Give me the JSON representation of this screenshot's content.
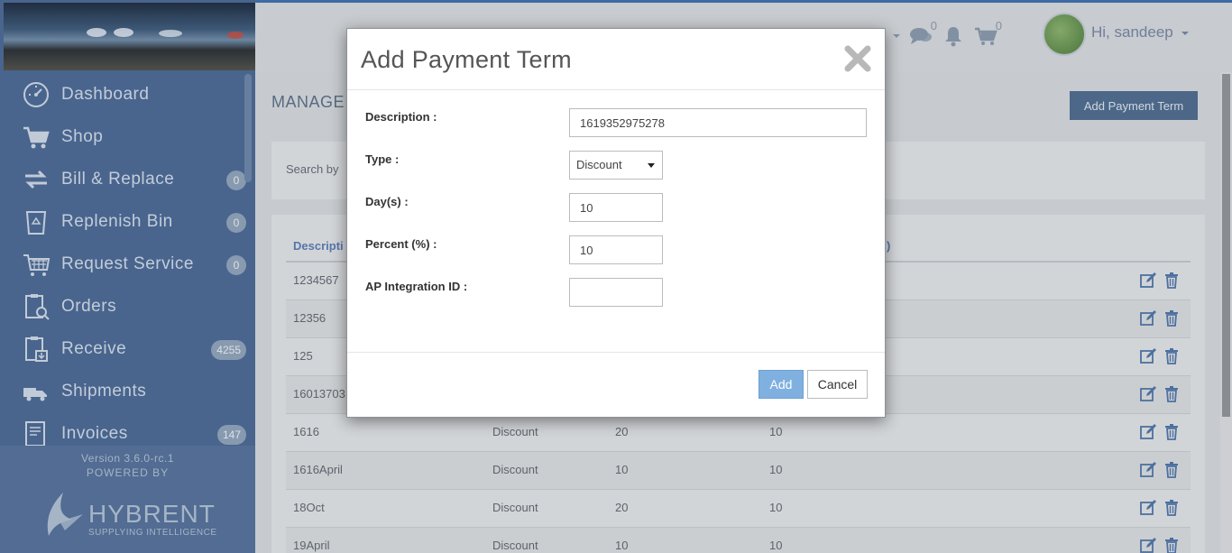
{
  "sidebar": {
    "items": [
      {
        "label": "Dashboard",
        "icon": "dashboard-icon",
        "badge": ""
      },
      {
        "label": "Shop",
        "icon": "cart-icon",
        "badge": ""
      },
      {
        "label": "Bill & Replace",
        "icon": "exchange-icon",
        "badge": "0"
      },
      {
        "label": "Replenish Bin",
        "icon": "recycle-bin-icon",
        "badge": "0"
      },
      {
        "label": "Request Service",
        "icon": "service-cart-icon",
        "badge": "0"
      },
      {
        "label": "Orders",
        "icon": "clipboard-search-icon",
        "badge": ""
      },
      {
        "label": "Receive",
        "icon": "clipboard-receive-icon",
        "badge": "4255"
      },
      {
        "label": "Shipments",
        "icon": "truck-icon",
        "badge": ""
      },
      {
        "label": "Invoices",
        "icon": "invoice-icon",
        "badge": "147"
      }
    ],
    "version": "Version 3.6.0-rc.1",
    "powered_by": "POWERED BY",
    "logo_word": "HYBRENT",
    "logo_tagline": "SUPPLYING INTELLIGENCE"
  },
  "header": {
    "messages_count": "0",
    "cart_count": "0",
    "greeting": "Hi, sandeep"
  },
  "page": {
    "title": "MANAGE",
    "add_button": "Add Payment Term",
    "search_label": "Search by",
    "columns": [
      "Descripti",
      ")"
    ],
    "rows": [
      {
        "description": "1234567",
        "type": "",
        "days": "",
        "percent": ""
      },
      {
        "description": "12356",
        "type": "",
        "days": "",
        "percent": ""
      },
      {
        "description": "125",
        "type": "",
        "days": "",
        "percent": ""
      },
      {
        "description": "16013703",
        "type": "",
        "days": "",
        "percent": ""
      },
      {
        "description": "1616",
        "type": "Discount",
        "days": "20",
        "percent": "10"
      },
      {
        "description": "1616April",
        "type": "Discount",
        "days": "10",
        "percent": "10"
      },
      {
        "description": "18Oct",
        "type": "Discount",
        "days": "20",
        "percent": "10"
      },
      {
        "description": "19April",
        "type": "Discount",
        "days": "10",
        "percent": "10"
      }
    ]
  },
  "modal": {
    "title": "Add Payment Term",
    "fields": {
      "description_label": "Description :",
      "description_value": "1619352975278",
      "type_label": "Type :",
      "type_value": "Discount",
      "days_label": "Day(s) :",
      "days_value": "10",
      "percent_label": "Percent (%) :",
      "percent_value": "10",
      "ap_label": "AP Integration ID :",
      "ap_value": ""
    },
    "add_button": "Add",
    "cancel_button": "Cancel"
  },
  "colors": {
    "sidebar": "#4a6893",
    "accent": "#3f6dab",
    "primary_button": "#7fb0e0"
  }
}
